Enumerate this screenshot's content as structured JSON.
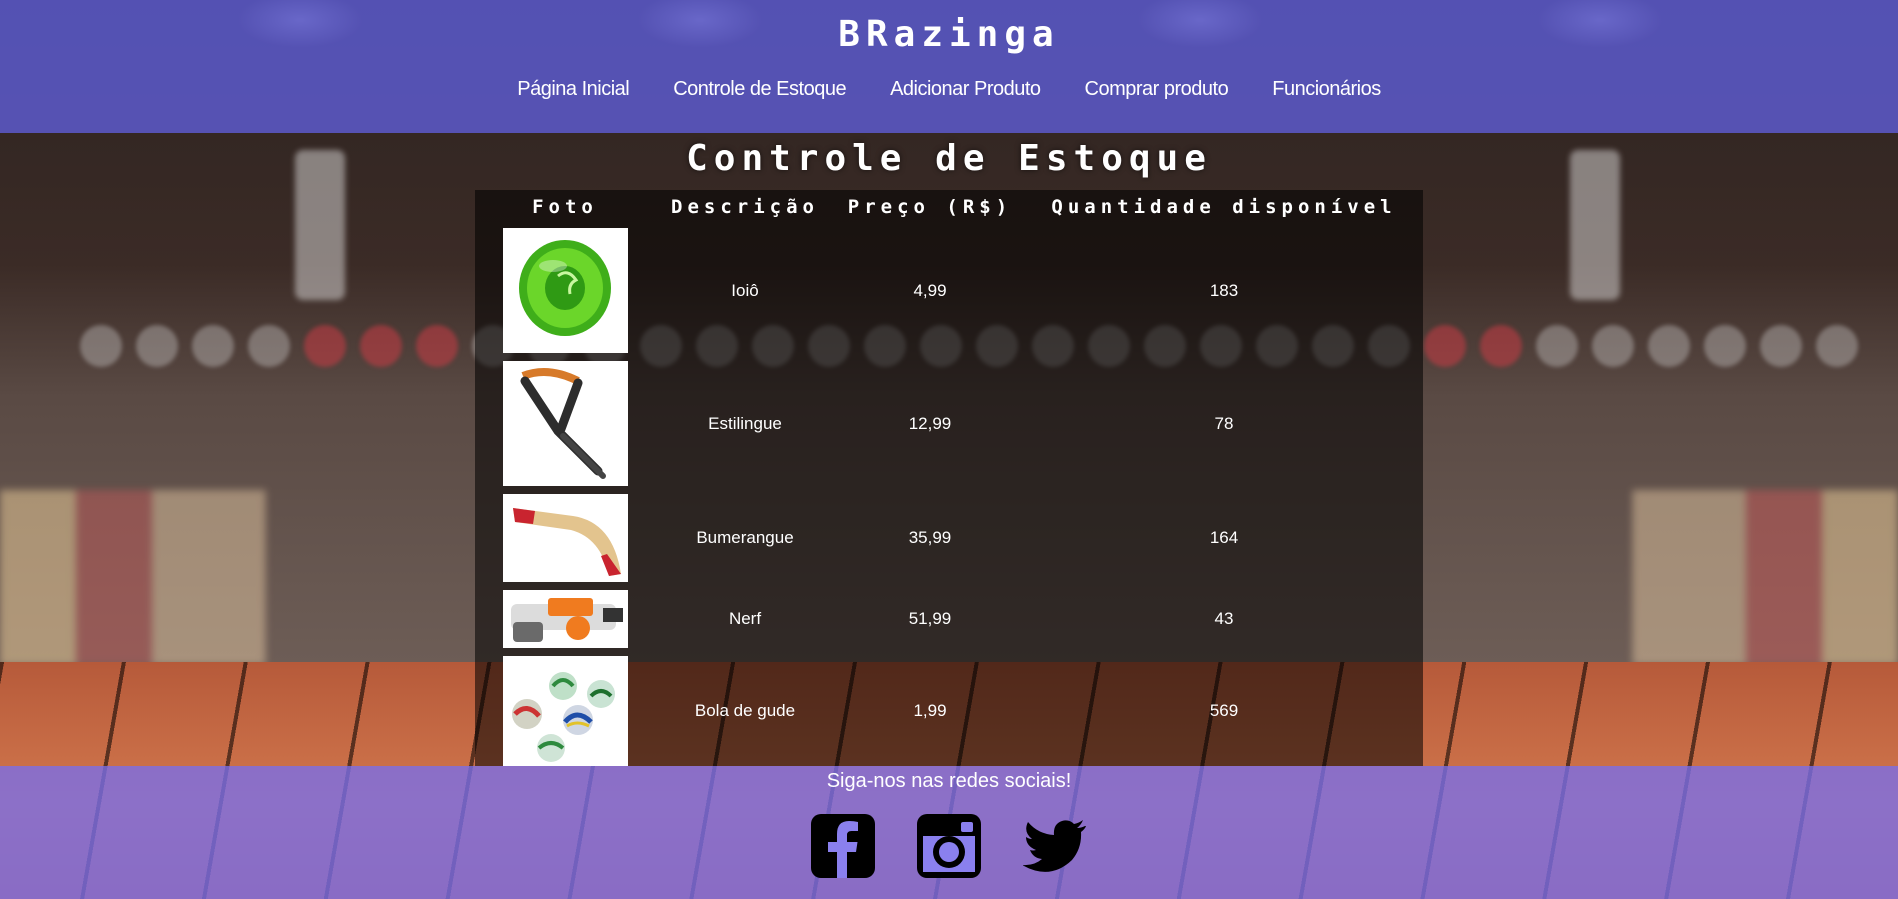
{
  "header": {
    "brand": "BRazinga",
    "nav": [
      {
        "label": "Página Inicial"
      },
      {
        "label": "Controle de Estoque"
      },
      {
        "label": "Adicionar Produto"
      },
      {
        "label": "Comprar produto"
      },
      {
        "label": "Funcionários"
      }
    ]
  },
  "main": {
    "title": "Controle de Estoque",
    "table": {
      "headers": [
        "Foto",
        "Descrição",
        "Preço (R$)",
        "Quantidade disponível"
      ],
      "rows": [
        {
          "description": "Ioiô",
          "price": "4,99",
          "quantity": "183",
          "image_icon": "yoyo-image"
        },
        {
          "description": "Estilingue",
          "price": "12,99",
          "quantity": "78",
          "image_icon": "slingshot-image"
        },
        {
          "description": "Bumerangue",
          "price": "35,99",
          "quantity": "164",
          "image_icon": "boomerang-image"
        },
        {
          "description": "Nerf",
          "price": "51,99",
          "quantity": "43",
          "image_icon": "nerf-image"
        },
        {
          "description": "Bola de gude",
          "price": "1,99",
          "quantity": "569",
          "image_icon": "marbles-image"
        }
      ]
    }
  },
  "footer": {
    "text": "Siga-nos nas redes sociais!",
    "social": [
      "facebook-icon",
      "instagram-icon",
      "twitter-icon"
    ]
  },
  "colors": {
    "header_overlay": "#6464eb",
    "footer_overlay": "#786eeb",
    "table_overlay": "#000000"
  }
}
